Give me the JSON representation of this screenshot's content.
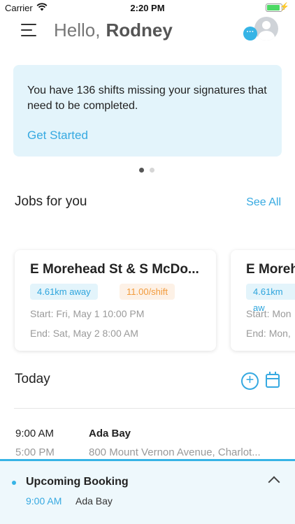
{
  "status_bar": {
    "carrier": "Carrier",
    "time": "2:20 PM"
  },
  "header": {
    "greeting": "Hello,",
    "user_name": "Rodney",
    "chat_badge": "···"
  },
  "banner": {
    "message": "You have 136 shifts missing your signatures that need to be completed.",
    "cta": "Get Started"
  },
  "jobs": {
    "title": "Jobs for you",
    "see_all": "See All",
    "cards": [
      {
        "title": "E Morehead St & S McDo...",
        "distance": "4.61km away",
        "rate": "11.00/shift",
        "start": "Start: Fri, May 1 10:00 PM",
        "end": "End: Sat, May 2 8:00 AM"
      },
      {
        "title": "E Morehead",
        "distance": "4.61km aw",
        "start": "Start: Mon",
        "end": "End: Mon,"
      }
    ]
  },
  "today": {
    "title": "Today",
    "shift": {
      "start": "9:00 AM",
      "end": "5:00 PM",
      "name": "Ada Bay",
      "address": "800 Mount Vernon Avenue, Charlot..."
    }
  },
  "upcoming": {
    "title": "Upcoming Booking",
    "time": "9:00 AM",
    "name": "Ada Bay"
  },
  "colors": {
    "accent": "#36a9e1",
    "banner_bg": "#e3f4fb",
    "rate_tag": "#f29a3a"
  }
}
